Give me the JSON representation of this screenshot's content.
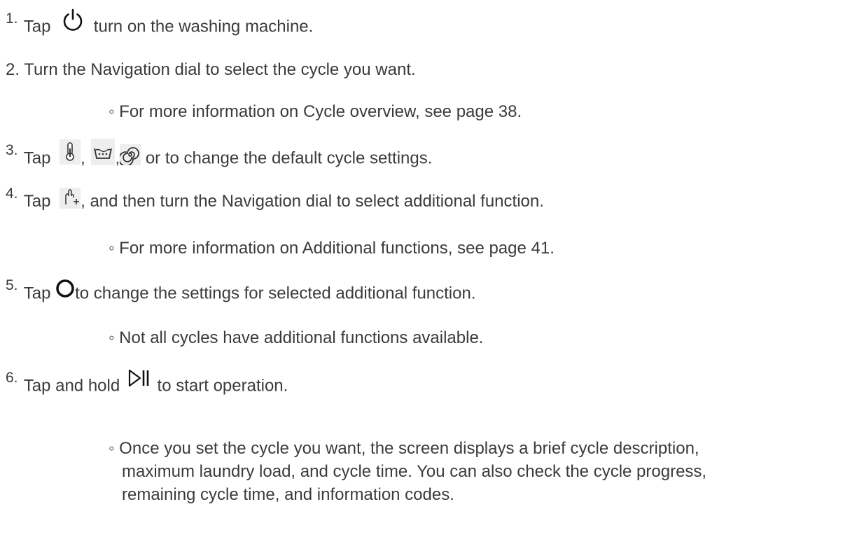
{
  "steps": [
    {
      "num": "1.",
      "text_a": "Tap",
      "icon": "power-icon",
      "text_b": "turn on the washing machine."
    },
    {
      "num": "2.",
      "text": "Turn the Navigation dial to select the cycle you want.",
      "note": "◦ For more information on Cycle overview, see page 38."
    },
    {
      "num": "3.",
      "text_a": "Tap",
      "icons": [
        "thermometer-icon",
        "wash-basin-icon",
        "spin-icon"
      ],
      "sep1": ",",
      "sep2": ",",
      "text_b": "or to change the default cycle settings."
    },
    {
      "num": "4.",
      "text_a": "Tap",
      "icon": "touch-plus-icon",
      "text_b": ", and then turn the Navigation dial to select additional function.",
      "note": "◦ For more information on Additional functions, see page 41."
    },
    {
      "num": "5.",
      "text_a": "Tap",
      "icon": "circle-icon",
      "text_b": "to change the settings for selected additional function.",
      "note": "◦ Not all cycles have additional functions available."
    },
    {
      "num": "6.",
      "text_a": "Tap and hold",
      "icon": "play-pause-icon",
      "text_b": "to start operation.",
      "note_lines": [
        "◦ Once you set the cycle you want, the screen displays a brief cycle description,",
        "maximum laundry load, and cycle time. You can also check the cycle progress,",
        "remaining cycle time, and information codes."
      ]
    }
  ]
}
